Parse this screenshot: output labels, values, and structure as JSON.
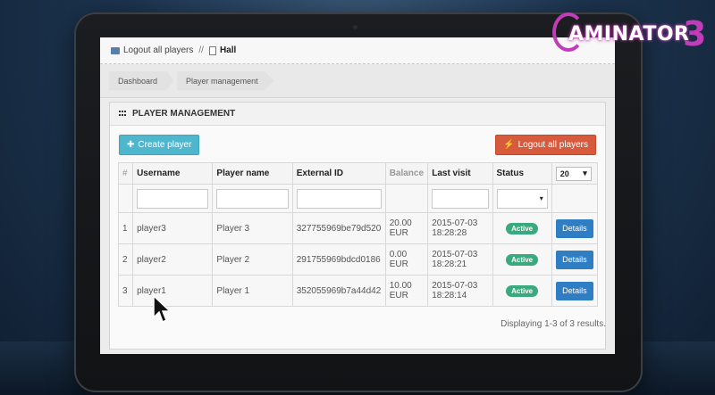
{
  "breadcrumb": {
    "logout_label": "Logout all players",
    "separator": "//",
    "hall_label": "Hall"
  },
  "tabs": [
    "Dashboard",
    "Player management"
  ],
  "panel": {
    "title": "PLAYER MANAGEMENT",
    "create_button": "Create player",
    "logout_button": "Logout all players"
  },
  "table": {
    "headers": {
      "num": "#",
      "username": "Username",
      "player_name": "Player name",
      "external_id": "External ID",
      "balance": "Balance",
      "last_visit": "Last visit",
      "status": "Status"
    },
    "page_size": "20",
    "rows": [
      {
        "num": "1",
        "username": "player3",
        "player_name": "Player 3",
        "external_id": "327755969be79d520",
        "balance_amount": "20.00",
        "balance_currency": "EUR",
        "date": "2015-07-03",
        "time": "18:28:28",
        "status": "Active",
        "action": "Details"
      },
      {
        "num": "2",
        "username": "player2",
        "player_name": "Player 2",
        "external_id": "291755969bdcd0186",
        "balance_amount": "0.00",
        "balance_currency": "EUR",
        "date": "2015-07-03",
        "time": "18:28:21",
        "status": "Active",
        "action": "Details"
      },
      {
        "num": "3",
        "username": "player1",
        "player_name": "Player 1",
        "external_id": "352055969b7a44d42",
        "balance_amount": "10.00",
        "balance_currency": "EUR",
        "date": "2015-07-03",
        "time": "18:28:14",
        "status": "Active",
        "action": "Details"
      }
    ]
  },
  "summary": "Displaying 1-3 of 3 results.",
  "logo": {
    "text": "AMINATOR",
    "suffix": "3"
  },
  "colors": {
    "create": "#4eb6cd",
    "logout": "#d65a3b",
    "active": "#3aaa7e",
    "details": "#2f7ec4",
    "logo": "#c03cb8"
  }
}
